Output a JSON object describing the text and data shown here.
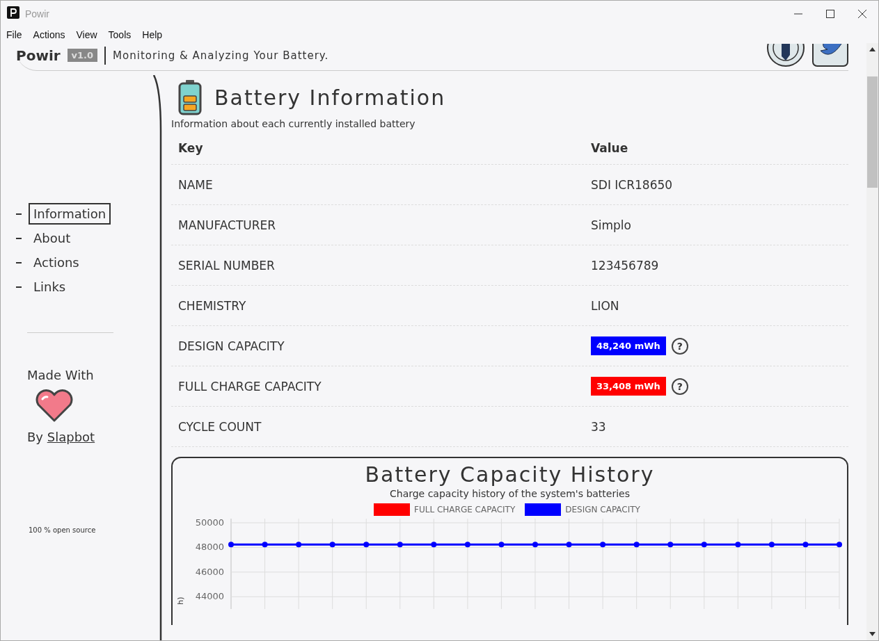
{
  "window": {
    "title": "Powir"
  },
  "menu": [
    "File",
    "Actions",
    "View",
    "Tools",
    "Help"
  ],
  "header": {
    "app_name": "Powir",
    "version": "v1.0",
    "tagline": "Monitoring & Analyzing Your Battery."
  },
  "sidebar": {
    "items": [
      {
        "label": "Information",
        "selected": true
      },
      {
        "label": "About",
        "selected": false
      },
      {
        "label": "Actions",
        "selected": false
      },
      {
        "label": "Links",
        "selected": false
      }
    ],
    "made_with": "Made With",
    "by": "By",
    "author": "Slapbot",
    "footer": "100 % open source"
  },
  "section": {
    "title": "Battery Information",
    "subtitle": "Information about each currently installed battery",
    "columns": [
      "Key",
      "Value"
    ],
    "rows": [
      {
        "key": "NAME",
        "value": "SDI ICR18650",
        "kind": "text"
      },
      {
        "key": "MANUFACTURER",
        "value": "Simplo",
        "kind": "text"
      },
      {
        "key": "SERIAL NUMBER",
        "value": "123456789",
        "kind": "text"
      },
      {
        "key": "CHEMISTRY",
        "value": "LION",
        "kind": "text"
      },
      {
        "key": "DESIGN CAPACITY",
        "value": "48,240 mWh",
        "kind": "badge",
        "color": "#0000ff",
        "help": "?"
      },
      {
        "key": "FULL CHARGE CAPACITY",
        "value": "33,408 mWh",
        "kind": "badge",
        "color": "#ff0000",
        "help": "?"
      },
      {
        "key": "CYCLE COUNT",
        "value": "33",
        "kind": "text"
      }
    ]
  },
  "history": {
    "title": "Battery Capacity History",
    "subtitle": "Charge capacity history of the system's batteries",
    "chart_data": {
      "type": "line",
      "grid": true,
      "ylabel": "h)",
      "ylim": [
        43000,
        50000
      ],
      "yticks": [
        44000,
        46000,
        48000,
        50000
      ],
      "series": [
        {
          "name": "FULL CHARGE CAPACITY",
          "color": "#ff0000",
          "values": [
            null,
            null,
            null,
            null,
            null,
            null,
            null,
            null,
            null,
            null,
            null,
            null,
            null,
            null,
            null,
            null,
            null,
            null,
            null
          ]
        },
        {
          "name": "DESIGN CAPACITY",
          "color": "#0000ff",
          "marker": true,
          "values": [
            48240,
            48240,
            48240,
            48240,
            48240,
            48240,
            48240,
            48240,
            48240,
            48240,
            48240,
            48240,
            48240,
            48240,
            48240,
            48240,
            48240,
            48240,
            48240
          ]
        }
      ]
    }
  }
}
